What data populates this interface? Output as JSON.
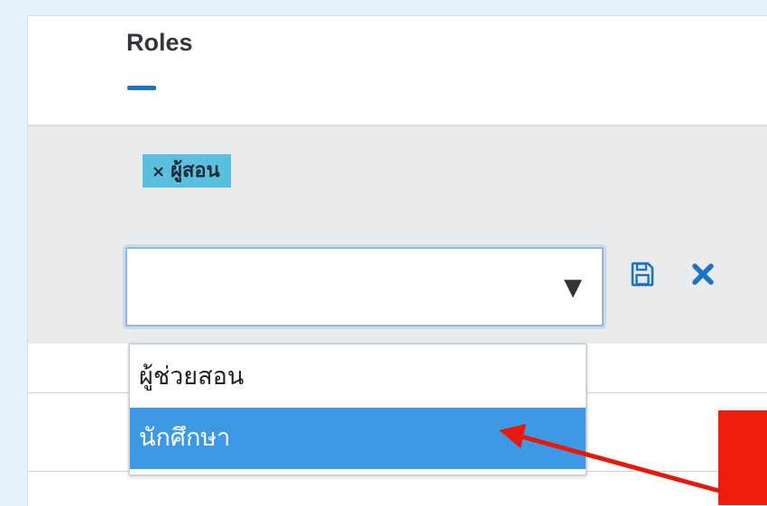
{
  "header": {
    "title": "Roles"
  },
  "roles_editor": {
    "selected_tags": [
      {
        "remove_glyph": "×",
        "label": "ผู้สอน"
      }
    ],
    "select": {
      "value": "",
      "arrow_glyph": "▼"
    },
    "actions": {
      "save_icon": "floppy-disk-icon",
      "cancel_icon": "close-x-icon"
    },
    "dropdown": {
      "options": [
        {
          "label": "ผู้ช่วยสอน",
          "highlighted": false
        },
        {
          "label": "นักศึกษา",
          "highlighted": true
        }
      ]
    }
  },
  "colors": {
    "accent": "#1b73c8",
    "tag_bg": "#5bc0de",
    "highlight": "#3d99e4",
    "annotation": "#ee1c0e"
  }
}
